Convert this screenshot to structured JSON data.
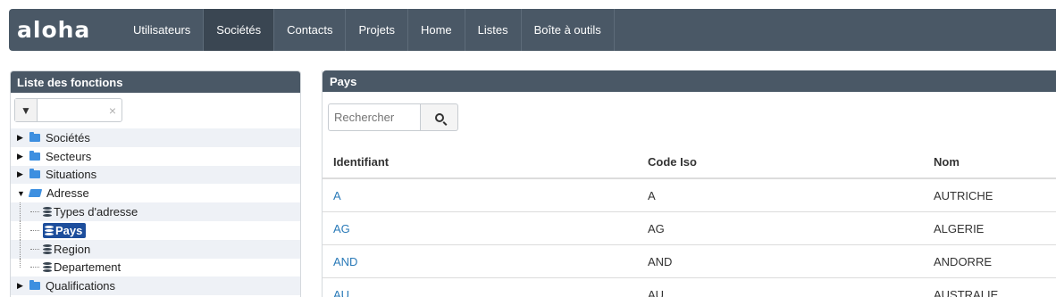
{
  "brand": "aloha",
  "nav": [
    "Utilisateurs",
    "Sociétés",
    "Contacts",
    "Projets",
    "Home",
    "Listes",
    "Boîte à outils"
  ],
  "nav_active": "Sociétés",
  "left_panel": {
    "title": "Liste des fonctions",
    "filter_value": "",
    "tree": {
      "societes": "Sociétés",
      "secteurs": "Secteurs",
      "situations": "Situations",
      "adresse": "Adresse",
      "types_adresse": "Types d'adresse",
      "pays": "Pays",
      "region": "Region",
      "departement": "Departement",
      "qualifications": "Qualifications"
    }
  },
  "right_panel": {
    "title": "Pays",
    "search_placeholder": "Rechercher",
    "columns": [
      "Identifiant",
      "Code Iso",
      "Nom"
    ],
    "rows": [
      [
        "A",
        "A",
        "AUTRICHE"
      ],
      [
        "AG",
        "AG",
        "ALGERIE"
      ],
      [
        "AND",
        "AND",
        "ANDORRE"
      ],
      [
        "AU",
        "AU",
        "AUSTRALIE"
      ]
    ]
  },
  "colors": {
    "header": "#4a5866",
    "link": "#2a7ab8",
    "selected": "#1d4e9c",
    "folder": "#3d8fe0"
  }
}
